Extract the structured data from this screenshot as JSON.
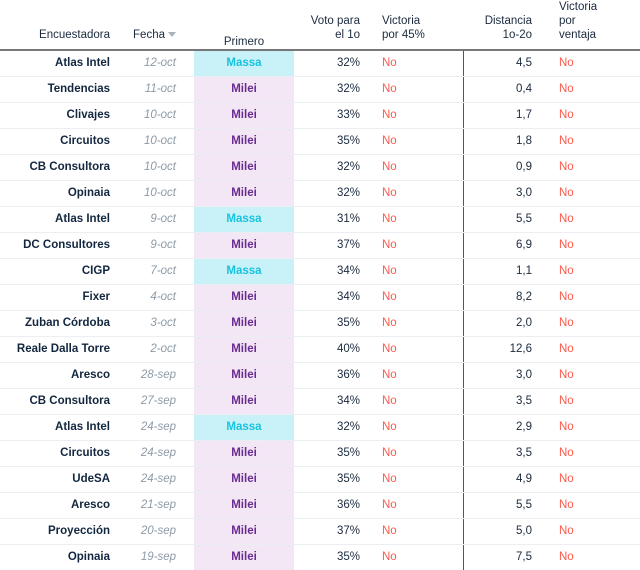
{
  "table": {
    "columns": [
      {
        "key": "pollster",
        "label": "Encuestadora",
        "align": "right",
        "sorted": false
      },
      {
        "key": "date",
        "label": "Fecha",
        "align": "right",
        "sorted": true,
        "sort_direction": "desc",
        "sort_icon": "caret-down-icon"
      },
      {
        "key": "first",
        "label": "Primero",
        "align": "center",
        "sorted": false
      },
      {
        "key": "vote_first",
        "label_lines": [
          "Voto para",
          "el 1o"
        ],
        "align": "right",
        "sorted": false
      },
      {
        "key": "win45",
        "label_lines": [
          "Victoria",
          "por 45%"
        ],
        "align": "left",
        "sorted": false
      },
      {
        "key": "gap",
        "label_lines": [
          "Distancia",
          "1o-2o"
        ],
        "align": "right",
        "sorted": false
      },
      {
        "key": "win_adv",
        "label_lines": [
          "Victoria",
          "por",
          "ventaja"
        ],
        "align": "left",
        "sorted": false
      }
    ],
    "header": {
      "pollster": "Encuestadora",
      "date": "Fecha",
      "first": "Primero",
      "vote_first_l1": "Voto para",
      "vote_first_l2": "el 1o",
      "win45_l1": "Victoria",
      "win45_l2": "por 45%",
      "gap_l1": "Distancia",
      "gap_l2": "1o-2o",
      "win_adv_l1": "Victoria",
      "win_adv_l2": "por",
      "win_adv_l3": "ventaja"
    },
    "rows": [
      {
        "pollster": "Atlas Intel",
        "date": "12-oct",
        "first": "Massa",
        "vote_first": "32%",
        "win45": "No",
        "gap": "4,5",
        "win_adv": "No"
      },
      {
        "pollster": "Tendencias",
        "date": "11-oct",
        "first": "Milei",
        "vote_first": "32%",
        "win45": "No",
        "gap": "0,4",
        "win_adv": "No"
      },
      {
        "pollster": "Clivajes",
        "date": "10-oct",
        "first": "Milei",
        "vote_first": "33%",
        "win45": "No",
        "gap": "1,7",
        "win_adv": "No"
      },
      {
        "pollster": "Circuitos",
        "date": "10-oct",
        "first": "Milei",
        "vote_first": "35%",
        "win45": "No",
        "gap": "1,8",
        "win_adv": "No"
      },
      {
        "pollster": "CB Consultora",
        "date": "10-oct",
        "first": "Milei",
        "vote_first": "32%",
        "win45": "No",
        "gap": "0,9",
        "win_adv": "No"
      },
      {
        "pollster": "Opinaia",
        "date": "10-oct",
        "first": "Milei",
        "vote_first": "32%",
        "win45": "No",
        "gap": "3,0",
        "win_adv": "No"
      },
      {
        "pollster": "Atlas Intel",
        "date": "9-oct",
        "first": "Massa",
        "vote_first": "31%",
        "win45": "No",
        "gap": "5,5",
        "win_adv": "No"
      },
      {
        "pollster": "DC Consultores",
        "date": "9-oct",
        "first": "Milei",
        "vote_first": "37%",
        "win45": "No",
        "gap": "6,9",
        "win_adv": "No"
      },
      {
        "pollster": "CIGP",
        "date": "7-oct",
        "first": "Massa",
        "vote_first": "34%",
        "win45": "No",
        "gap": "1,1",
        "win_adv": "No"
      },
      {
        "pollster": "Fixer",
        "date": "4-oct",
        "first": "Milei",
        "vote_first": "34%",
        "win45": "No",
        "gap": "8,2",
        "win_adv": "No"
      },
      {
        "pollster": "Zuban Córdoba",
        "date": "3-oct",
        "first": "Milei",
        "vote_first": "35%",
        "win45": "No",
        "gap": "2,0",
        "win_adv": "No"
      },
      {
        "pollster": "Reale Dalla Torre",
        "date": "2-oct",
        "first": "Milei",
        "vote_first": "40%",
        "win45": "No",
        "gap": "12,6",
        "win_adv": "No"
      },
      {
        "pollster": "Aresco",
        "date": "28-sep",
        "first": "Milei",
        "vote_first": "36%",
        "win45": "No",
        "gap": "3,0",
        "win_adv": "No"
      },
      {
        "pollster": "CB Consultora",
        "date": "27-sep",
        "first": "Milei",
        "vote_first": "34%",
        "win45": "No",
        "gap": "3,5",
        "win_adv": "No"
      },
      {
        "pollster": "Atlas Intel",
        "date": "24-sep",
        "first": "Massa",
        "vote_first": "32%",
        "win45": "No",
        "gap": "2,9",
        "win_adv": "No"
      },
      {
        "pollster": "Circuitos",
        "date": "24-sep",
        "first": "Milei",
        "vote_first": "35%",
        "win45": "No",
        "gap": "3,5",
        "win_adv": "No"
      },
      {
        "pollster": "UdeSA",
        "date": "24-sep",
        "first": "Milei",
        "vote_first": "35%",
        "win45": "No",
        "gap": "4,9",
        "win_adv": "No"
      },
      {
        "pollster": "Aresco",
        "date": "21-sep",
        "first": "Milei",
        "vote_first": "36%",
        "win45": "No",
        "gap": "5,5",
        "win_adv": "No"
      },
      {
        "pollster": "Proyección",
        "date": "20-sep",
        "first": "Milei",
        "vote_first": "37%",
        "win45": "No",
        "gap": "5,0",
        "win_adv": "No"
      },
      {
        "pollster": "Opinaia",
        "date": "19-sep",
        "first": "Milei",
        "vote_first": "35%",
        "win45": "No",
        "gap": "7,5",
        "win_adv": "No"
      }
    ]
  },
  "colors": {
    "massa_background": "#c8f2f8",
    "massa_text": "#17c3e0",
    "milei_background": "#f3e6f5",
    "milei_text": "#6b2c91",
    "negative_text": "#fa5a4b",
    "header_text": "#1b2a3d",
    "date_text": "#8d9aa6",
    "row_divider": "#eceff1",
    "header_rule": "#777777",
    "vertical_rule": "#555555"
  }
}
